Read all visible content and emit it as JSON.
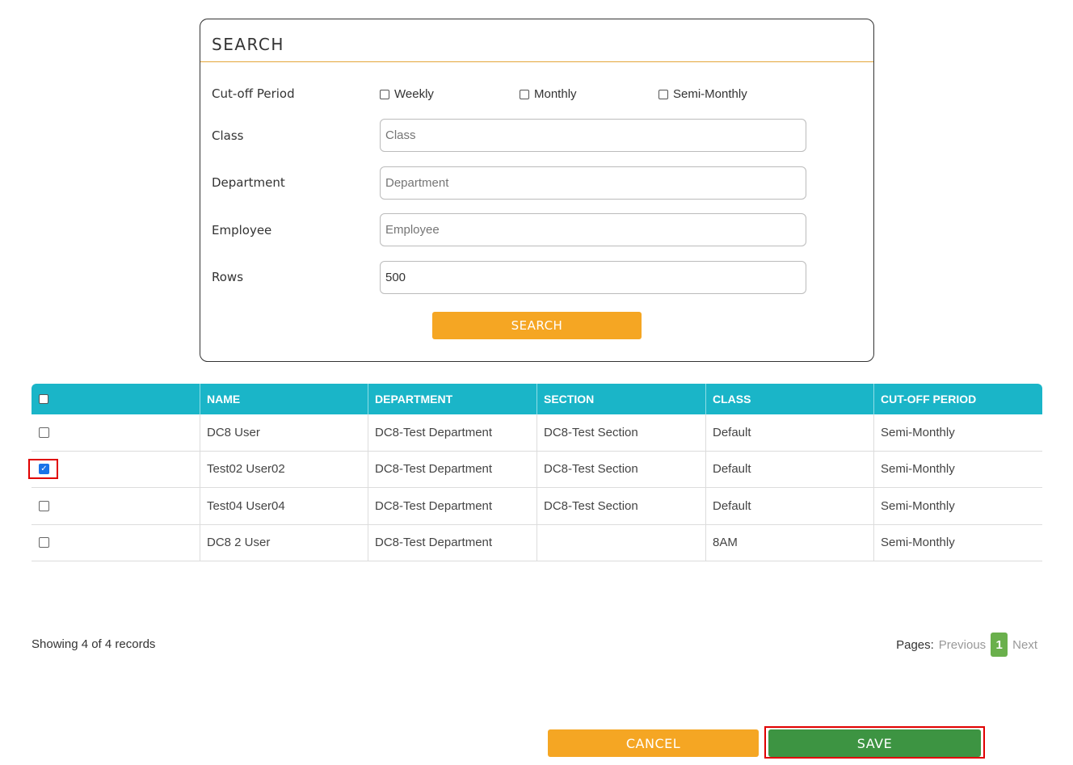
{
  "search": {
    "title": "SEARCH",
    "cutoff_label": "Cut-off Period",
    "cutoff_options": [
      {
        "label": "Weekly",
        "checked": false
      },
      {
        "label": "Monthly",
        "checked": false
      },
      {
        "label": "Semi-Monthly",
        "checked": false
      }
    ],
    "class_label": "Class",
    "class_placeholder": "Class",
    "class_value": "",
    "department_label": "Department",
    "department_placeholder": "Department",
    "department_value": "",
    "employee_label": "Employee",
    "employee_placeholder": "Employee",
    "employee_value": "",
    "rows_label": "Rows",
    "rows_value": "500",
    "button_label": "SEARCH"
  },
  "table": {
    "headers": [
      "NAME",
      "DEPARTMENT",
      "SECTION",
      "CLASS",
      "CUT-OFF PERIOD"
    ],
    "rows": [
      {
        "checked": false,
        "name": "DC8 User",
        "department": "DC8-Test Department",
        "section": "DC8-Test Section",
        "class": "Default",
        "cutoff": "Semi-Monthly"
      },
      {
        "checked": true,
        "name": "Test02 User02",
        "department": "DC8-Test Department",
        "section": "DC8-Test Section",
        "class": "Default",
        "cutoff": "Semi-Monthly"
      },
      {
        "checked": false,
        "name": "Test04 User04",
        "department": "DC8-Test Department",
        "section": "DC8-Test Section",
        "class": "Default",
        "cutoff": "Semi-Monthly"
      },
      {
        "checked": false,
        "name": "DC8 2 User",
        "department": "DC8-Test Department",
        "section": "",
        "class": "8AM",
        "cutoff": "Semi-Monthly"
      }
    ]
  },
  "footer": {
    "records_info": "Showing 4 of 4 records",
    "pages_label": "Pages:",
    "previous": "Previous",
    "current_page": "1",
    "next": "Next"
  },
  "actions": {
    "cancel_label": "CANCEL",
    "save_label": "SAVE"
  },
  "colors": {
    "accent_orange": "#f5a623",
    "table_header": "#1ab5c8",
    "save_green": "#3d9442",
    "highlight_red": "#e00000"
  }
}
